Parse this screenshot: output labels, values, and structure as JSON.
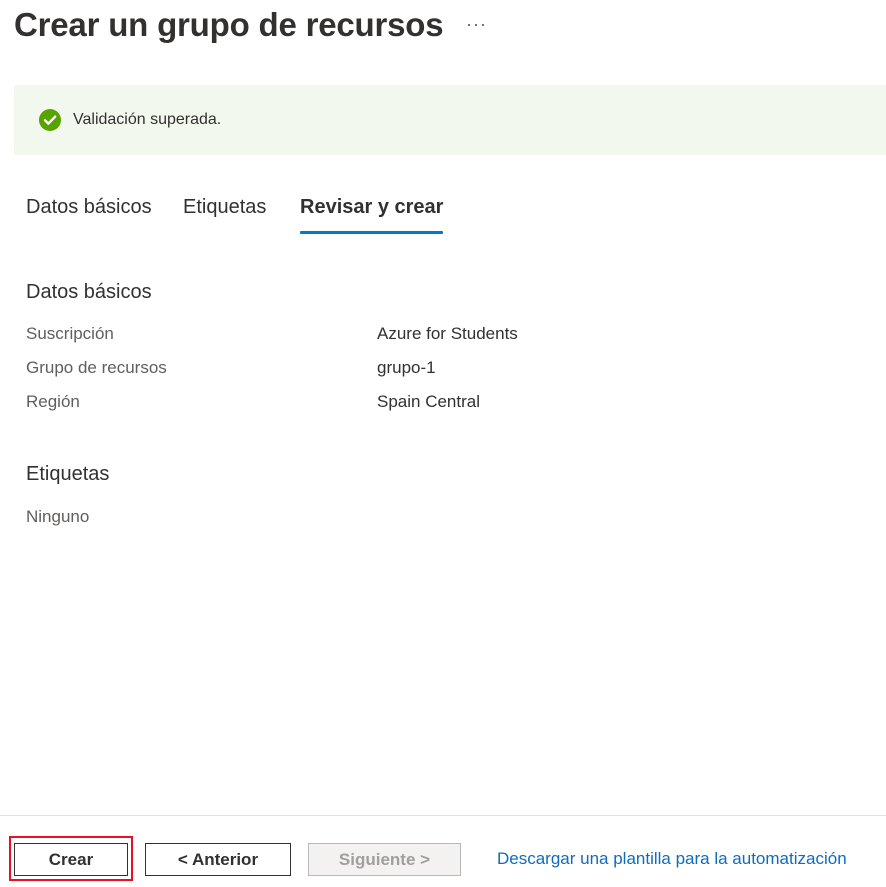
{
  "header": {
    "title": "Crear un grupo de recursos",
    "more_label": "···"
  },
  "banner": {
    "message": "Validación superada.",
    "icon": "check-circle-icon",
    "color": "#57a300"
  },
  "tabs": [
    {
      "label": "Datos básicos",
      "active": false
    },
    {
      "label": "Etiquetas",
      "active": false
    },
    {
      "label": "Revisar y crear",
      "active": true
    }
  ],
  "basics": {
    "heading": "Datos básicos",
    "rows": [
      {
        "label": "Suscripción",
        "value": "Azure for Students"
      },
      {
        "label": "Grupo de recursos",
        "value": "grupo-1"
      },
      {
        "label": "Región",
        "value": "Spain Central"
      }
    ]
  },
  "tags": {
    "heading": "Etiquetas",
    "value": "Ninguno"
  },
  "footer": {
    "create_label": "Crear",
    "previous_label": "< Anterior",
    "next_label": "Siguiente >",
    "download_link": "Descargar una plantilla para la automatización"
  },
  "colors": {
    "accent": "#0078d4",
    "link": "#0f6cbd",
    "highlight": "#e81123"
  }
}
